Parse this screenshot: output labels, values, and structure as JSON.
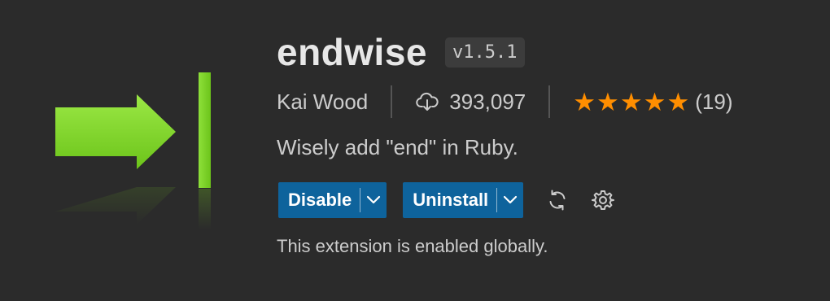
{
  "extension": {
    "name": "endwise",
    "version": "v1.5.1",
    "publisher": "Kai Wood",
    "install_count": "393,097",
    "rating_stars": 5,
    "rating_count": "(19)",
    "description": "Wisely add \"end\" in Ruby.",
    "status_text": "This extension is enabled globally."
  },
  "actions": {
    "disable_label": "Disable",
    "uninstall_label": "Uninstall"
  },
  "icons": {
    "logo": "arrow-into-bar-logo",
    "install": "cloud-download-icon",
    "star": "star-icon",
    "sync": "sync-icon",
    "settings": "gear-icon",
    "dropdown": "chevron-down-icon"
  },
  "colors": {
    "accent_button": "#0e639c",
    "star": "#ff8e00",
    "logo_green": "#7ed321"
  }
}
